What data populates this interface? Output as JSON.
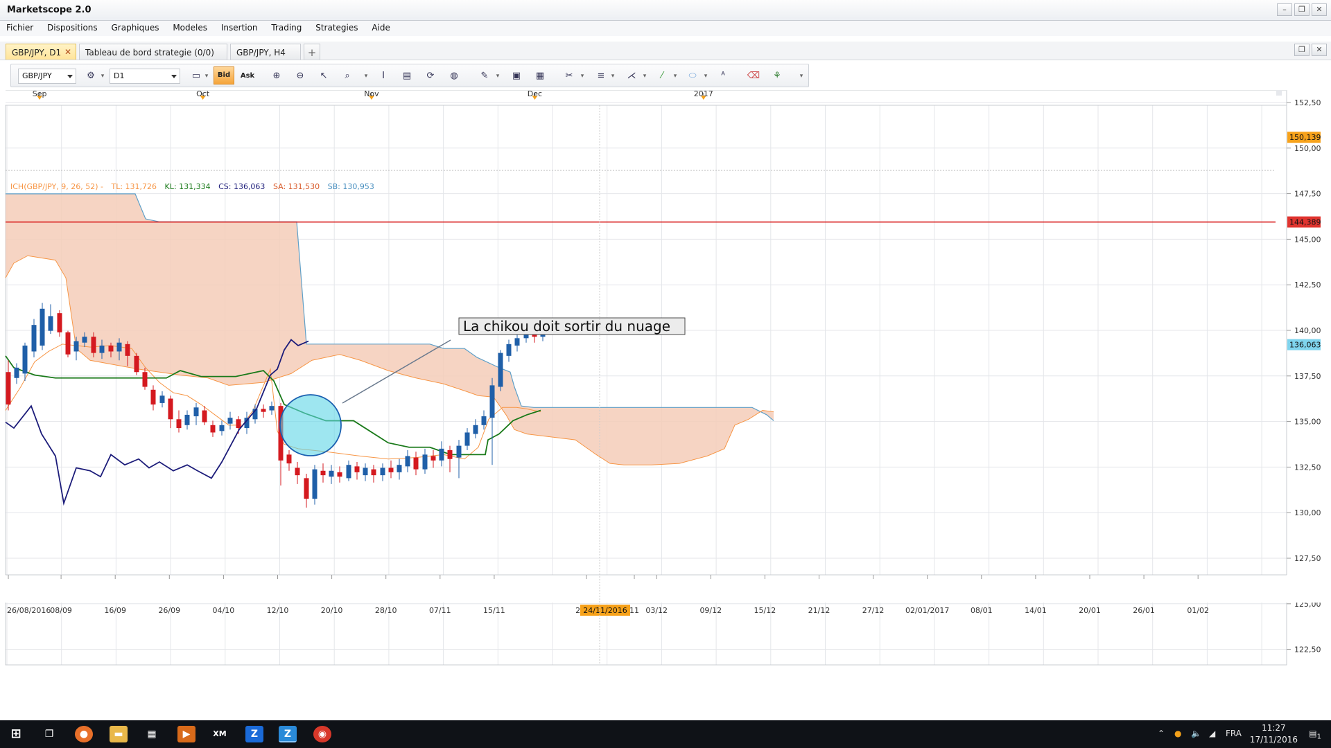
{
  "window": {
    "title": "Marketscope 2.0"
  },
  "menu": [
    "Fichier",
    "Dispositions",
    "Graphiques",
    "Modeles",
    "Insertion",
    "Trading",
    "Strategies",
    "Aide"
  ],
  "tabs": [
    {
      "label": "GBP/JPY, D1",
      "active": true
    },
    {
      "label": "Tableau de bord strategie (0/0)",
      "active": false
    },
    {
      "label": "GBP/JPY, H4",
      "active": false
    }
  ],
  "toolbar": {
    "symbol": "GBP/JPY",
    "timeframe": "D1",
    "bid_label": "Bid",
    "ask_label": "Ask"
  },
  "chart": {
    "months": [
      {
        "label": "Sep",
        "date": "2016-09-01"
      },
      {
        "label": "Oct",
        "date": "2016-10-01"
      },
      {
        "label": "Nov",
        "date": "2016-11-01"
      },
      {
        "label": "Dec",
        "date": "2016-12-01"
      },
      {
        "label": "2017",
        "date": "2017-01-01"
      }
    ],
    "date_ticks": [
      "26/08/2016",
      "08/09",
      "16/09",
      "26/09",
      "04/10",
      "12/10",
      "20/10",
      "28/10",
      "07/11",
      "15/11",
      "21/11",
      "24/11/2016",
      "11",
      "03/12",
      "09/12",
      "15/12",
      "21/12",
      "27/12",
      "02/01/2017",
      "08/01",
      "14/01",
      "20/01",
      "26/01",
      "01/02"
    ],
    "highlighted_date": "24/11/2016",
    "y_ticks": [
      "152,50",
      "150,00",
      "147,50",
      "145,00",
      "142,50",
      "140,00",
      "137,50",
      "135,00",
      "132,50",
      "130,00",
      "127,50",
      "125,00",
      "122,50"
    ],
    "ylim": [
      122.5,
      152.5
    ],
    "indicator": {
      "name": "ICH(GBP/JPY, 9, 26, 52) -",
      "tl": "TL: 131,726",
      "kl": "KL: 131,334",
      "cs": "CS: 136,063",
      "sa": "SA: 131,530",
      "sb": "SB: 130,953"
    },
    "price_markers": [
      {
        "label": "150,139",
        "value": 150.139,
        "color": "#f7a21b"
      },
      {
        "label": "144,389",
        "value": 144.389,
        "color": "#e0342f"
      },
      {
        "label": "136,063",
        "value": 136.063,
        "color": "#7fd4ee"
      }
    ],
    "annotation": {
      "text": "La chikou doit sortir du nuage"
    },
    "colors": {
      "cloud": "#f5cdb8",
      "tenkan": "#f79646",
      "kijun": "#1a7a1a",
      "chikou": "#1c1c7a",
      "senkou_b": "#5fa0c8",
      "bull": "#1f5fa8",
      "bear": "#d4191f",
      "level": "#d81b1b"
    }
  },
  "taskbar": {
    "language": "FRA",
    "time": "11:27",
    "date": "17/11/2016",
    "notifications": "1"
  }
}
